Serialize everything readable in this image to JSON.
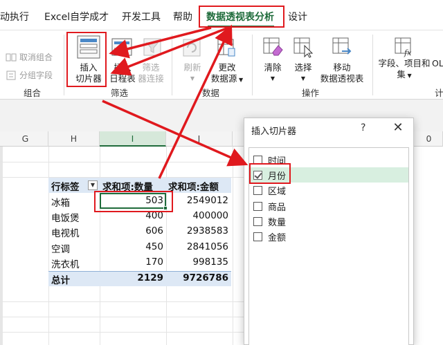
{
  "tabs": [
    "动执行",
    "Excel自学成才",
    "开发工具",
    "帮助",
    "数据透视表分析",
    "设计"
  ],
  "ribbon": {
    "group_group": {
      "ungroup": "取消组合",
      "group_field": "分组字段",
      "label": "组合"
    },
    "filter_group": {
      "insert_slicer_line1": "插入",
      "insert_slicer_line2": "切片器",
      "insert_timeline_line1": "插入",
      "insert_timeline_line2": "日程表",
      "filter_conn_line1": "筛选",
      "filter_conn_line2": "器连接",
      "label": "筛选"
    },
    "data_group": {
      "refresh": "刷新",
      "change_source_line1": "更改",
      "change_source_line2": "数据源",
      "label": "数据"
    },
    "actions_group": {
      "clear": "清除",
      "select": "选择",
      "move_line1": "移动",
      "move_line2": "数据透视表",
      "label": "操作"
    },
    "calc_group": {
      "fields_line1": "字段、项目和",
      "fields_line2": "集",
      "extra": "OL",
      "label": "计"
    }
  },
  "sheet": {
    "columns": [
      "G",
      "H",
      "I",
      "J"
    ],
    "partial_column": "0",
    "pivot": {
      "headers": [
        "行标签",
        "求和项:数量",
        "求和项:金额"
      ],
      "rows": [
        {
          "label": "冰箱",
          "qty": "503",
          "amount": "2549012"
        },
        {
          "label": "电饭煲",
          "qty": "400",
          "amount": "400000"
        },
        {
          "label": "电视机",
          "qty": "606",
          "amount": "2938583"
        },
        {
          "label": "空调",
          "qty": "450",
          "amount": "2841056"
        },
        {
          "label": "洗衣机",
          "qty": "170",
          "amount": "998135"
        }
      ],
      "total": {
        "label": "总计",
        "qty": "2129",
        "amount": "9726786"
      }
    }
  },
  "dialog": {
    "title": "插入切片器",
    "help": "?",
    "close": "✕",
    "items": [
      {
        "label": "时间",
        "checked": false
      },
      {
        "label": "月份",
        "checked": true
      },
      {
        "label": "区域",
        "checked": false
      },
      {
        "label": "商品",
        "checked": false
      },
      {
        "label": "数量",
        "checked": false
      },
      {
        "label": "金额",
        "checked": false
      }
    ]
  },
  "colors": {
    "accent_green": "#1e6b3a",
    "annotation_red": "#e0191e",
    "pivot_header_blue": "#dde8f5",
    "slicer_highlight": "#d8efe0"
  },
  "icons": [
    "ungroup-icon",
    "group-field-icon",
    "slicer-icon",
    "timeline-icon",
    "filter-connection-icon",
    "refresh-icon",
    "change-source-icon",
    "clear-icon",
    "select-icon",
    "move-pivot-icon",
    "fields-items-icon",
    "dropdown-arrow-icon"
  ]
}
